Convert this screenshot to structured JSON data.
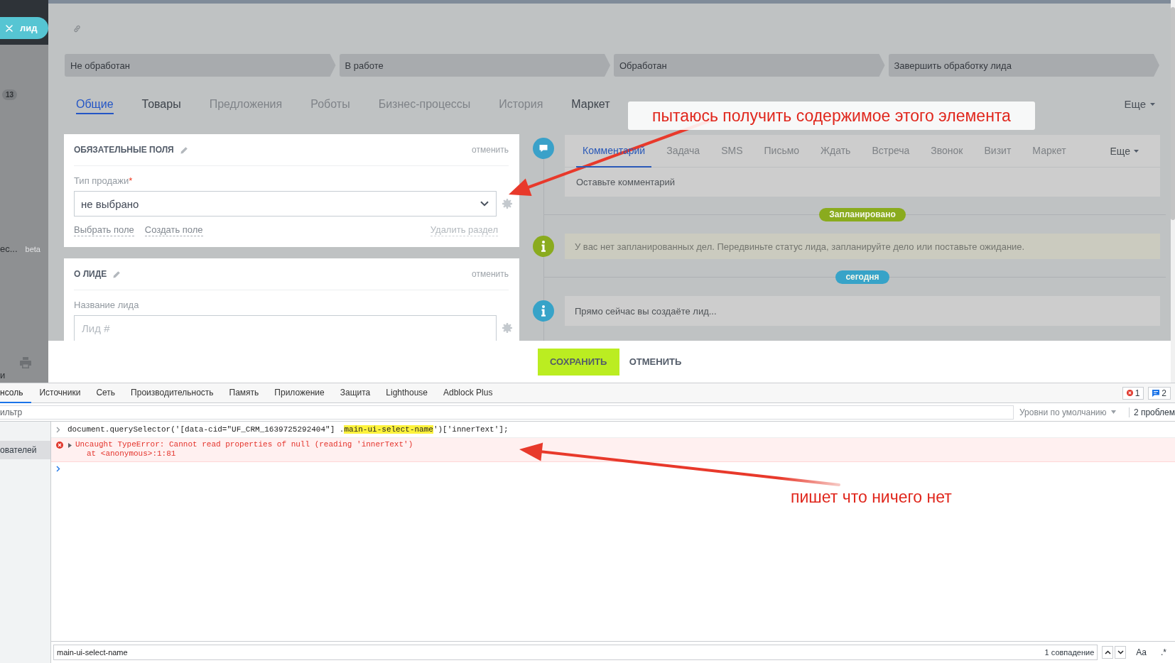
{
  "sidebar": {
    "tag": "лид",
    "counter": "13",
    "item": "ес...",
    "item_badge": "beta",
    "footer_text": "и"
  },
  "stages": [
    {
      "label": "Не обработан"
    },
    {
      "label": "В работе"
    },
    {
      "label": "Обработан"
    },
    {
      "label": "Завершить обработку лида"
    }
  ],
  "tabs": [
    {
      "label": "Общие",
      "selected": true,
      "disabled": false
    },
    {
      "label": "Товары",
      "selected": false,
      "disabled": false
    },
    {
      "label": "Предложения",
      "selected": false,
      "disabled": true
    },
    {
      "label": "Роботы",
      "selected": false,
      "disabled": true
    },
    {
      "label": "Бизнес-процессы",
      "selected": false,
      "disabled": true
    },
    {
      "label": "История",
      "selected": false,
      "disabled": true
    },
    {
      "label": "Маркет",
      "selected": false,
      "disabled": false
    }
  ],
  "tabs_more": "Еще",
  "sections": [
    {
      "title": "ОБЯЗАТЕЛЬНЫЕ ПОЛЯ",
      "cancel": "отменить",
      "fields": [
        {
          "kind": "select",
          "label": "Тип продажи",
          "required_mark": "*",
          "value": "не выбрано"
        }
      ],
      "links": [
        "Выбрать поле",
        "Создать поле"
      ],
      "delete": "Удалить раздел"
    },
    {
      "title": "О ЛИДЕ",
      "cancel": "отменить",
      "fields": [
        {
          "kind": "input",
          "label": "Название лида",
          "placeholder": "Лид #"
        }
      ]
    }
  ],
  "activity": {
    "tabs": [
      {
        "label": "Комментарий",
        "selected": true
      },
      {
        "label": "Задача",
        "selected": false
      },
      {
        "label": "SMS",
        "selected": false
      },
      {
        "label": "Письмо",
        "selected": false
      },
      {
        "label": "Ждать",
        "selected": false
      },
      {
        "label": "Встреча",
        "selected": false
      },
      {
        "label": "Звонок",
        "selected": false
      },
      {
        "label": "Визит",
        "selected": false
      },
      {
        "label": "Маркет",
        "selected": false
      }
    ],
    "more": "Еще",
    "comment": {
      "placeholder": "Оставьте комментарий"
    }
  },
  "timeline": [
    {
      "kind": "pill",
      "text": "Запланировано",
      "color": "#8aab1e"
    },
    {
      "kind": "notice",
      "text": "У вас нет запланированных дел. Передвиньте статус лида, запланируйте дело или поставьте ожидание.",
      "color": "#8aab1e"
    },
    {
      "kind": "pill",
      "text": "сегодня",
      "color": "#37a3c8"
    },
    {
      "kind": "entry",
      "text": "Прямо сейчас вы создаёте лид...",
      "color": "#37a3c8"
    }
  ],
  "footer": {
    "save": "СОХРАНИТЬ",
    "cancel": "ОТМЕНИТЬ"
  },
  "devtools": {
    "tabs": [
      {
        "label": "нсоль",
        "selected": true
      },
      {
        "label": "Источники",
        "selected": false
      },
      {
        "label": "Сеть",
        "selected": false
      },
      {
        "label": "Производительность",
        "selected": false
      },
      {
        "label": "Память",
        "selected": false
      },
      {
        "label": "Приложение",
        "selected": false
      },
      {
        "label": "Защита",
        "selected": false
      },
      {
        "label": "Lighthouse",
        "selected": false
      },
      {
        "label": "Adblock Plus",
        "selected": false
      }
    ],
    "error_count": "1",
    "message_count": "2",
    "filter": {
      "placeholder": "ильтр"
    },
    "levels": "Уровни по умолчанию",
    "issues": "2 проблем",
    "sidebar": [
      {
        "label": "ователей",
        "selected": true
      }
    ],
    "console": [
      {
        "kind": "input",
        "parts": [
          {
            "text": "document.querySelector('[data-cid=\"UF_CRM_1639725292404\"] .",
            "highlighted": false
          },
          {
            "text": "main-ui-select-name",
            "highlighted": true
          },
          {
            "text": "')['innerText'];",
            "highlighted": false
          }
        ]
      },
      {
        "kind": "error",
        "expanded": false,
        "message": "Uncaught TypeError: Cannot read properties of null (reading 'innerText')",
        "trace": "at <anonymous>:1:81"
      },
      {
        "kind": "prompt"
      }
    ],
    "search": {
      "value": "main-ui-select-name",
      "matches": "1 совпадение",
      "case_toggle": "Aa",
      "regex_toggle": ".*"
    }
  },
  "annotations": {
    "top_note": "пытаюсь получить содержимое этого элемента",
    "bottom_note": "пишет что ничего нет"
  }
}
